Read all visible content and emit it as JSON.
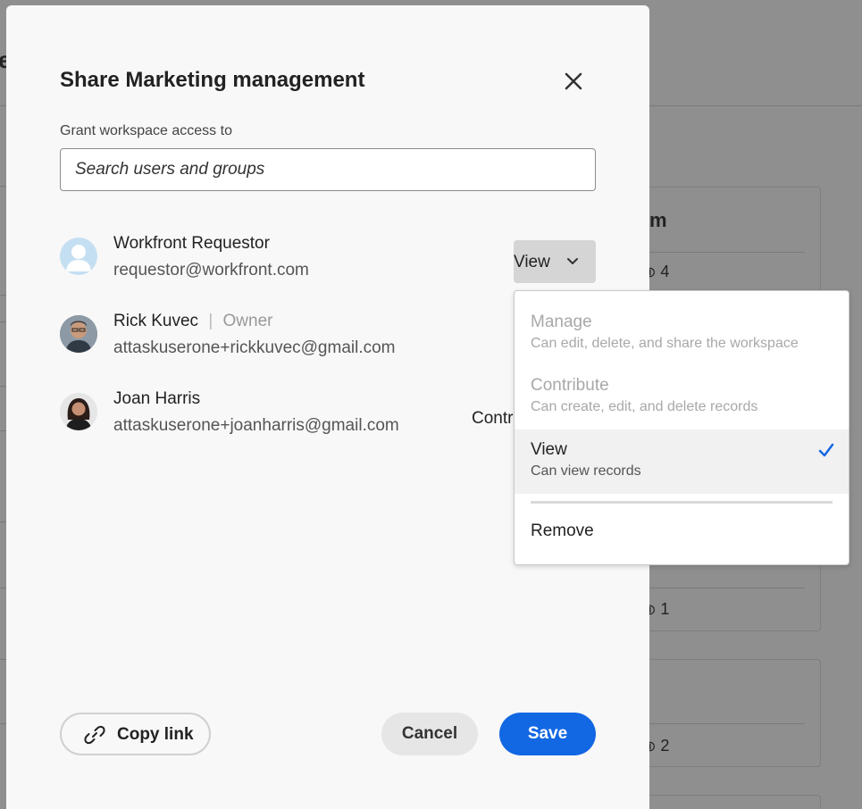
{
  "background": {
    "page_title_fragment": "e",
    "card_title_fragment": "m",
    "counts": [
      "4",
      "1",
      "2"
    ]
  },
  "modal": {
    "title": "Share Marketing management",
    "grant_label": "Grant workspace access to",
    "search_placeholder": "Search users and groups",
    "users": [
      {
        "name": "Workfront Requestor",
        "email": "requestor@workfront.com",
        "permission": "View"
      },
      {
        "name": "Rick Kuvec",
        "separator": "|",
        "role": "Owner",
        "email": "attaskuserone+rickkuvec@gmail.com"
      },
      {
        "name": "Joan Harris",
        "email": "attaskuserone+joanharris@gmail.com",
        "permission": "Contribute"
      }
    ],
    "copy_link_label": "Copy link",
    "cancel_label": "Cancel",
    "save_label": "Save"
  },
  "permission_menu": {
    "items": [
      {
        "label": "Manage",
        "description": "Can edit, delete, and share the workspace",
        "state": "disabled"
      },
      {
        "label": "Contribute",
        "description": "Can create, edit, and delete records",
        "state": "disabled"
      },
      {
        "label": "View",
        "description": "Can view records",
        "state": "selected"
      }
    ],
    "remove_label": "Remove"
  },
  "colors": {
    "accent": "#1267e3",
    "overlay": "#8f8f8f",
    "modal_bg": "#f8f8f8"
  }
}
